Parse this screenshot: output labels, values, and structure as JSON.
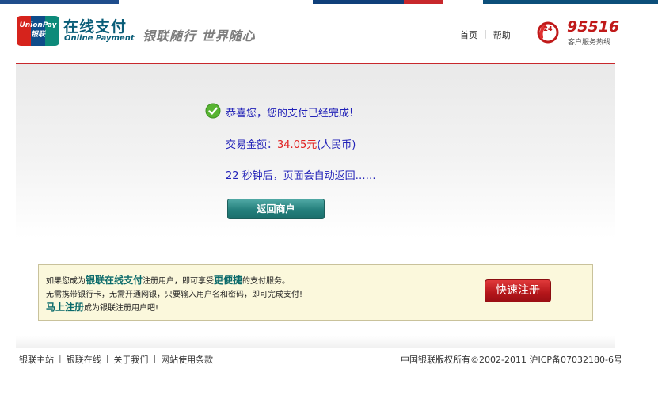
{
  "colors": {
    "teal": "#0a5d78",
    "unionpay_red": "#d6231c",
    "unionpay_blue": "#0f4c8a",
    "unionpay_teal": "#0d8a7a",
    "success_green": "#58b432",
    "message_blue": "#2222b8",
    "amount_red": "#e02020",
    "register_red": "#c01a1a"
  },
  "header": {
    "logo_badge_text": "UnionPay 银联",
    "logo_cn": "在线支付",
    "logo_en": "Online Payment",
    "slogan": "银联随行 世界随心",
    "nav": {
      "home": "首页",
      "sep": "|",
      "help": "帮助"
    },
    "hotline_icon_text": "24",
    "hotline_number": "95516",
    "hotline_label": "客户服务热线"
  },
  "result": {
    "success_icon": "check-circle-icon",
    "message": "恭喜您，您的支付已经完成!",
    "amount_label": "交易金额：",
    "amount_value": "34.05元",
    "amount_currency": "(人民币)",
    "countdown_seconds": "22",
    "countdown_text": " 秒钟后，页面会自动返回……",
    "return_button": "返回商户"
  },
  "promo": {
    "line1_a": "如果您成为",
    "line1_b": "银联在线支付",
    "line1_c": "注册用户，即可享受",
    "line1_d": "更便捷",
    "line1_e": "的支付服务。",
    "line2": "无需携带银行卡，无需开通网银，只要输入用户名和密码，即可完成支付!",
    "line3_a": "马上注册",
    "line3_b": "成为银联注册用户吧!",
    "register_button": "快速注册"
  },
  "footer": {
    "links": [
      "银联主站",
      "银联在线",
      "关于我们",
      "网站使用条款"
    ],
    "sep": "|",
    "copyright": "中国银联版权所有©2002-2011 沪ICP备07032180-6号"
  }
}
